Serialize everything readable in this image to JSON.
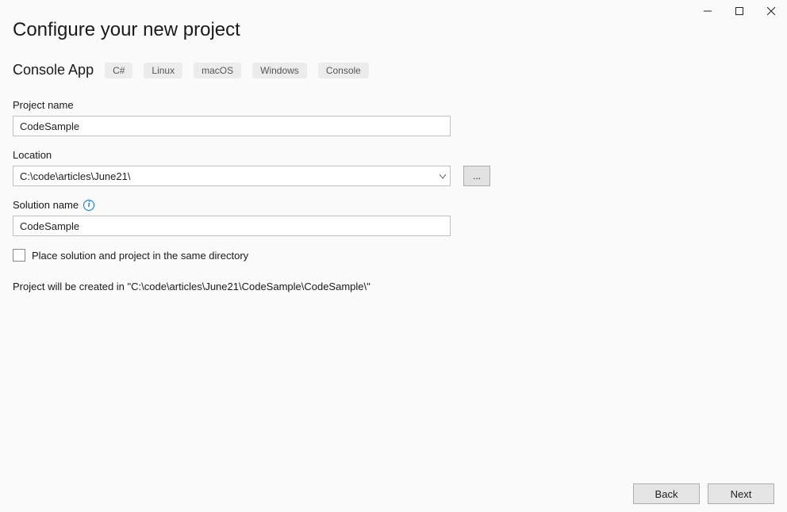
{
  "window": {
    "minimize": "–",
    "maximize": "☐",
    "close": "✕"
  },
  "title": "Configure your new project",
  "template": {
    "name": "Console App",
    "tags": [
      "C#",
      "Linux",
      "macOS",
      "Windows",
      "Console"
    ]
  },
  "fields": {
    "project_name": {
      "label": "Project name",
      "value": "CodeSample"
    },
    "location": {
      "label": "Location",
      "value": "C:\\code\\articles\\June21\\",
      "browse": "..."
    },
    "solution_name": {
      "label": "Solution name",
      "value": "CodeSample",
      "info_tip": "i"
    },
    "same_dir": {
      "label": "Place solution and project in the same directory",
      "checked": false
    }
  },
  "path_preview": "Project will be created in \"C:\\code\\articles\\June21\\CodeSample\\CodeSample\\\"",
  "buttons": {
    "back": "Back",
    "next": "Next"
  }
}
